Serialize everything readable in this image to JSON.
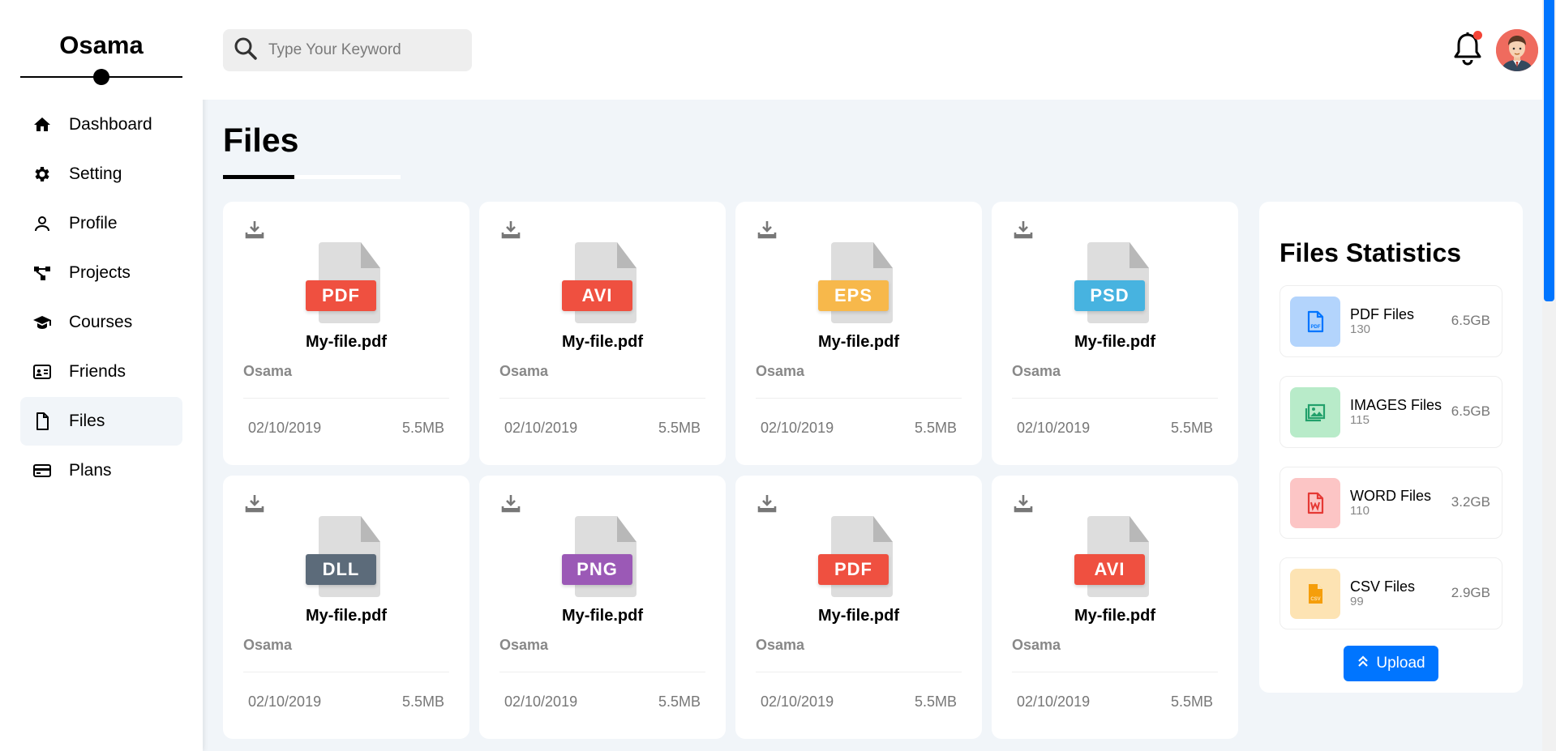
{
  "sidebar": {
    "brand": "Osama",
    "items": [
      {
        "label": "Dashboard",
        "icon": "home-icon"
      },
      {
        "label": "Setting",
        "icon": "gear-icon"
      },
      {
        "label": "Profile",
        "icon": "user-icon"
      },
      {
        "label": "Projects",
        "icon": "diagram-icon"
      },
      {
        "label": "Courses",
        "icon": "graduation-cap-icon"
      },
      {
        "label": "Friends",
        "icon": "id-card-icon"
      },
      {
        "label": "Files",
        "icon": "file-icon",
        "active": true
      },
      {
        "label": "Plans",
        "icon": "credit-card-icon"
      }
    ]
  },
  "header": {
    "search_placeholder": "Type Your Keyword",
    "notification_icon": "bell-icon",
    "has_notification": true
  },
  "page": {
    "title": "Files"
  },
  "files": [
    {
      "type": "PDF",
      "color": "#ef5040",
      "name": "My-file.pdf",
      "owner": "Osama",
      "date": "02/10/2019",
      "size": "5.5MB"
    },
    {
      "type": "AVI",
      "color": "#ef5040",
      "name": "My-file.pdf",
      "owner": "Osama",
      "date": "02/10/2019",
      "size": "5.5MB"
    },
    {
      "type": "EPS",
      "color": "#f7b84b",
      "name": "My-file.pdf",
      "owner": "Osama",
      "date": "02/10/2019",
      "size": "5.5MB"
    },
    {
      "type": "PSD",
      "color": "#47b3e0",
      "name": "My-file.pdf",
      "owner": "Osama",
      "date": "02/10/2019",
      "size": "5.5MB"
    },
    {
      "type": "DLL",
      "color": "#5c6b7a",
      "name": "My-file.pdf",
      "owner": "Osama",
      "date": "02/10/2019",
      "size": "5.5MB"
    },
    {
      "type": "PNG",
      "color": "#9b59b6",
      "name": "My-file.pdf",
      "owner": "Osama",
      "date": "02/10/2019",
      "size": "5.5MB"
    },
    {
      "type": "PDF",
      "color": "#ef5040",
      "name": "My-file.pdf",
      "owner": "Osama",
      "date": "02/10/2019",
      "size": "5.5MB"
    },
    {
      "type": "AVI",
      "color": "#ef5040",
      "name": "My-file.pdf",
      "owner": "Osama",
      "date": "02/10/2019",
      "size": "5.5MB"
    }
  ],
  "stats": {
    "title": "Files Statistics",
    "items": [
      {
        "label": "PDF Files",
        "count": "130",
        "amount": "6.5GB",
        "bg": "#b3d4fc",
        "fg": "#0075ff",
        "icon": "pdf-file-icon"
      },
      {
        "label": "IMAGES Files",
        "count": "115",
        "amount": "6.5GB",
        "bg": "#b8ebc9",
        "fg": "#22a06b",
        "icon": "images-icon"
      },
      {
        "label": "WORD Files",
        "count": "110",
        "amount": "3.2GB",
        "bg": "#fcc5c5",
        "fg": "#e53935",
        "icon": "word-file-icon"
      },
      {
        "label": "CSV Files",
        "count": "99",
        "amount": "2.9GB",
        "bg": "#fde3b3",
        "fg": "#f59e0b",
        "icon": "csv-file-icon"
      }
    ],
    "upload_label": "Upload"
  },
  "colors": {
    "accent": "#0075ff",
    "page_bg": "#f1f5f9"
  }
}
